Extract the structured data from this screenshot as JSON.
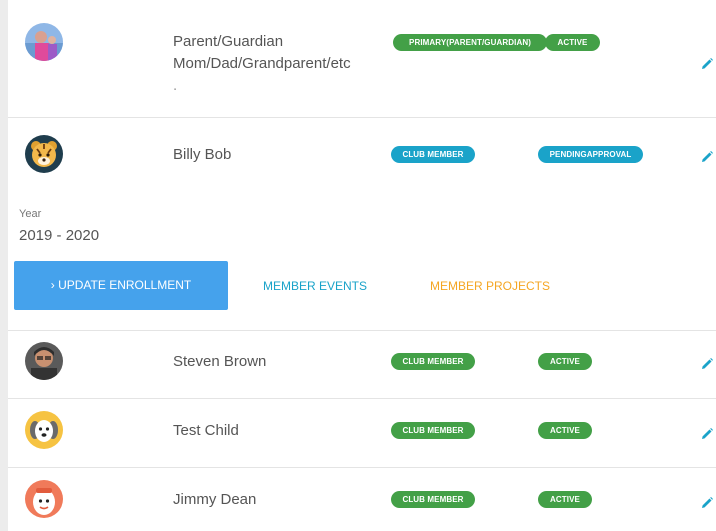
{
  "rows": [
    {
      "name_line1": "Parent/Guardian",
      "name_line2": "Mom/Dad/Grandparent/etc",
      "name_line3": ".",
      "badge1": "PRIMARY(PARENT/GUARDIAN)",
      "badge2": "ACTIVE"
    },
    {
      "name": "Billy Bob",
      "badge1": "CLUB MEMBER",
      "badge2": "PENDINGAPPROVAL",
      "year_label": "Year",
      "year_value": "2019 - 2020"
    },
    {
      "name": "Steven Brown",
      "badge1": "CLUB MEMBER",
      "badge2": "ACTIVE"
    },
    {
      "name": "Test Child",
      "badge1": "CLUB MEMBER",
      "badge2": "ACTIVE"
    },
    {
      "name": "Jimmy Dean",
      "badge1": "CLUB MEMBER",
      "badge2": "ACTIVE"
    }
  ],
  "actions": {
    "update_enrollment": "› UPDATE ENROLLMENT",
    "member_events": "MEMBER EVENTS",
    "member_projects": "MEMBER PROJECTS"
  },
  "colors": {
    "green": "#43a047",
    "blue": "#1aa3c9",
    "button": "#45a2ec",
    "projects": "#f5a623"
  },
  "icons": {
    "edit": "pencil-icon"
  }
}
